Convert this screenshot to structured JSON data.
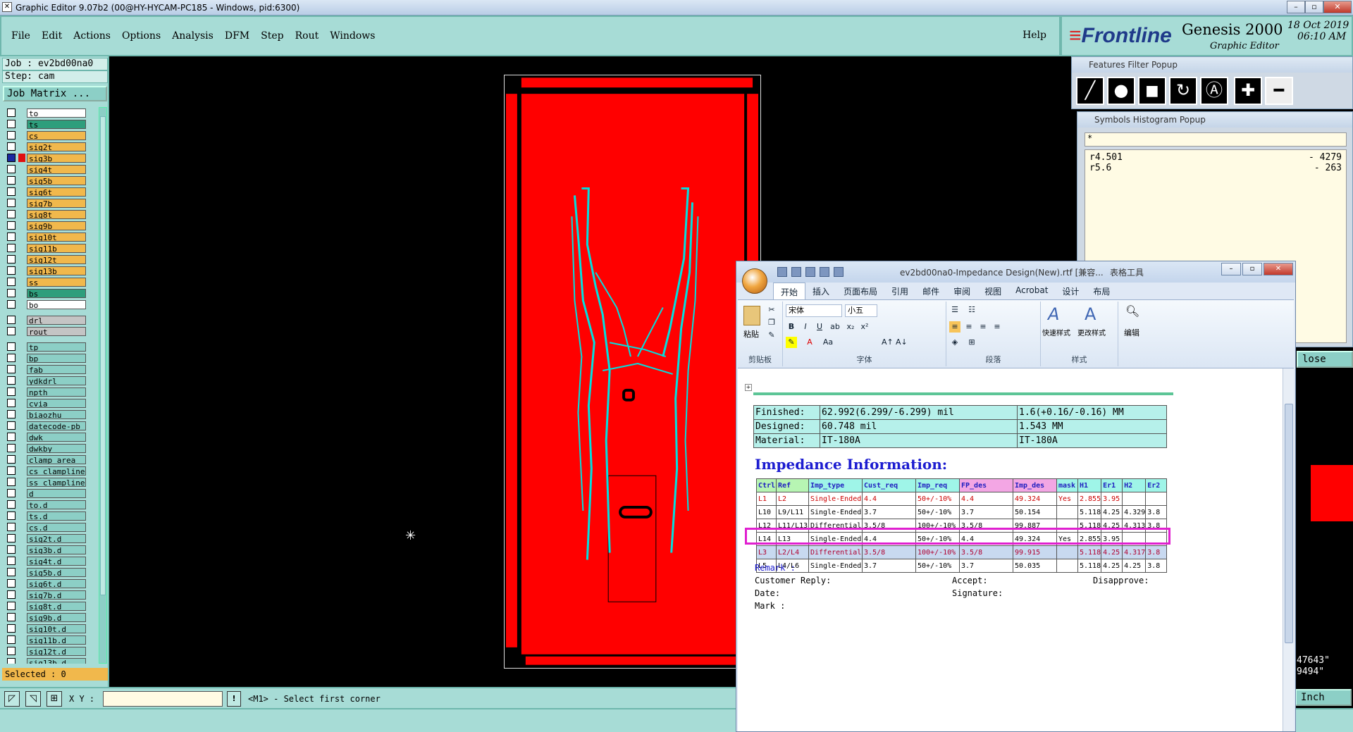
{
  "window": {
    "title": "Graphic Editor 9.07b2 (00@HY-HYCAM-PC185 - Windows, pid:6300)"
  },
  "menu": {
    "items": [
      "File",
      "Edit",
      "Actions",
      "Options",
      "Analysis",
      "DFM",
      "Step",
      "Rout",
      "Windows"
    ],
    "help": "Help"
  },
  "logo": {
    "brand": "Frontline",
    "product": "Genesis 2000",
    "subtitle": "Graphic Editor",
    "date": "18 Oct 2019",
    "time": "06:10 AM"
  },
  "job": {
    "job_label": "Job : ev2bd00na0",
    "step_label": "Step: cam",
    "matrix_button": "Job Matrix ..."
  },
  "layers": {
    "group1": [
      {
        "name": "to",
        "color": "#ffffff"
      },
      {
        "name": "ts",
        "color": "#2e9e7c"
      },
      {
        "name": "cs",
        "color": "#f1b84c"
      },
      {
        "name": "sig2t",
        "color": "#f1b84c"
      },
      {
        "name": "sig3b",
        "color": "#f1b84c",
        "active": true
      },
      {
        "name": "sig4t",
        "color": "#f1b84c"
      },
      {
        "name": "sig5b",
        "color": "#f1b84c"
      },
      {
        "name": "sig6t",
        "color": "#f1b84c"
      },
      {
        "name": "sig7b",
        "color": "#f1b84c"
      },
      {
        "name": "sig8t",
        "color": "#f1b84c"
      },
      {
        "name": "sig9b",
        "color": "#f1b84c"
      },
      {
        "name": "sig10t",
        "color": "#f1b84c"
      },
      {
        "name": "sig11b",
        "color": "#f1b84c"
      },
      {
        "name": "sig12t",
        "color": "#f1b84c"
      },
      {
        "name": "sig13b",
        "color": "#f1b84c"
      },
      {
        "name": "ss",
        "color": "#f1b84c"
      },
      {
        "name": "bs",
        "color": "#2e9e7c"
      },
      {
        "name": "bo",
        "color": "#ffffff"
      }
    ],
    "group2": [
      {
        "name": "drl",
        "color": "#c4c4c4"
      },
      {
        "name": "rout",
        "color": "#c4c4c4"
      }
    ],
    "group3": [
      {
        "name": "tp",
        "color": "#8ccfc6"
      },
      {
        "name": "bp",
        "color": "#8ccfc6"
      },
      {
        "name": "fab",
        "color": "#8ccfc6"
      },
      {
        "name": "ydkdrl",
        "color": "#8ccfc6"
      },
      {
        "name": "npth",
        "color": "#8ccfc6"
      },
      {
        "name": "cvia",
        "color": "#8ccfc6"
      },
      {
        "name": "biaozhu",
        "color": "#8ccfc6"
      },
      {
        "name": "datecode-pb",
        "color": "#8ccfc6"
      },
      {
        "name": "dwk",
        "color": "#8ccfc6"
      },
      {
        "name": "dwkby",
        "color": "#8ccfc6"
      },
      {
        "name": "clamp_area",
        "color": "#8ccfc6"
      },
      {
        "name": "cs_clampline",
        "color": "#8ccfc6"
      },
      {
        "name": "ss_clampline",
        "color": "#8ccfc6"
      },
      {
        "name": "d",
        "color": "#8ccfc6"
      },
      {
        "name": "to.d",
        "color": "#8ccfc6"
      },
      {
        "name": "ts.d",
        "color": "#8ccfc6"
      },
      {
        "name": "cs.d",
        "color": "#8ccfc6"
      },
      {
        "name": "sig2t.d",
        "color": "#8ccfc6"
      },
      {
        "name": "sig3b.d",
        "color": "#8ccfc6"
      },
      {
        "name": "sig4t.d",
        "color": "#8ccfc6"
      },
      {
        "name": "sig5b.d",
        "color": "#8ccfc6"
      },
      {
        "name": "sig6t.d",
        "color": "#8ccfc6"
      },
      {
        "name": "sig7b.d",
        "color": "#8ccfc6"
      },
      {
        "name": "sig8t.d",
        "color": "#8ccfc6"
      },
      {
        "name": "sig9b.d",
        "color": "#8ccfc6"
      },
      {
        "name": "sig10t.d",
        "color": "#8ccfc6"
      },
      {
        "name": "sig11b.d",
        "color": "#8ccfc6"
      },
      {
        "name": "sig12t.d",
        "color": "#8ccfc6"
      },
      {
        "name": "sig13b.d",
        "color": "#8ccfc6"
      }
    ]
  },
  "selected": "Selected : 0",
  "bottom": {
    "xy_label": "X Y :",
    "xy_value": "",
    "prompt": "<M1> - Select first corner"
  },
  "features_filter": {
    "title": "Features Filter Popup"
  },
  "symbols_histogram": {
    "title": "Symbols Histogram Popup",
    "filter": "*",
    "rows": [
      {
        "sym": "r4.501",
        "count": "- 4279"
      },
      {
        "sym": "r5.6",
        "count": "- 263"
      }
    ],
    "close": "lose"
  },
  "right_misc": {
    "coord1": "47643\"",
    "coord2": "9494\"",
    "inch": "Inch"
  },
  "word": {
    "title": "ev2bd00na0-Impedance Design(New).rtf [兼容...",
    "context_tab": "表格工具",
    "tabs": [
      "开始",
      "插入",
      "页面布局",
      "引用",
      "邮件",
      "审阅",
      "视图",
      "Acrobat",
      "设计",
      "布局"
    ],
    "font_name": "宋体",
    "font_size": "小五",
    "groups": {
      "clipboard": "剪贴板",
      "font": "字体",
      "paragraph": "段落",
      "styles": "样式",
      "paste": "粘贴",
      "quick_styles": "快速样式",
      "change_styles": "更改样式",
      "edit": "编辑"
    },
    "info_rows": [
      {
        "label": "Finished:",
        "mil": "62.992(6.299/-6.299) mil",
        "mm": "1.6(+0.16/-0.16) MM"
      },
      {
        "label": "Designed:",
        "mil": "60.748 mil",
        "mm": "1.543 MM"
      },
      {
        "label": "Material:",
        "mil": "IT-180A",
        "mm": "IT-180A"
      }
    ],
    "imp_title": "Impedance Information:",
    "imp_headers": [
      "Ctrl",
      "Ref",
      "Imp_type",
      "Cust_req",
      "Imp_req",
      "FP_des",
      "Imp_des",
      "mask",
      "H1",
      "Er1",
      "H2",
      "Er2"
    ],
    "imp_rows": [
      [
        "L1",
        "L2",
        "Single-Ended",
        "4.4",
        "50+/-10%",
        "4.4",
        "49.324",
        "Yes",
        "2.855",
        "3.95",
        "",
        ""
      ],
      [
        "L10",
        "L9/L11",
        "Single-Ended",
        "3.7",
        "50+/-10%",
        "3.7",
        "50.154",
        "",
        "5.118",
        "4.25",
        "4.329",
        "3.8"
      ],
      [
        "L12",
        "L11/L13",
        "Differential",
        "3.5/8",
        "100+/-10%",
        "3.5/8",
        "99.887",
        "",
        "5.118",
        "4.25",
        "4.313",
        "3.8"
      ],
      [
        "L14",
        "L13",
        "Single-Ended",
        "4.4",
        "50+/-10%",
        "4.4",
        "49.324",
        "Yes",
        "2.855",
        "3.95",
        "",
        ""
      ],
      [
        "L3",
        "L2/L4",
        "Differential",
        "3.5/8",
        "100+/-10%",
        "3.5/8",
        "99.915",
        "",
        "5.118",
        "4.25",
        "4.317",
        "3.8"
      ],
      [
        "L5",
        "L4/L6",
        "Single-Ended",
        "3.7",
        "50+/-10%",
        "3.7",
        "50.035",
        "",
        "5.118",
        "4.25",
        "4.25",
        "3.8"
      ]
    ],
    "remark": "Remark :",
    "customer_reply": "Customer Reply:",
    "accept": "Accept:",
    "disapprove": "Disapprove:",
    "date": "Date:",
    "signature": "Signature:",
    "mark": "Mark :"
  }
}
